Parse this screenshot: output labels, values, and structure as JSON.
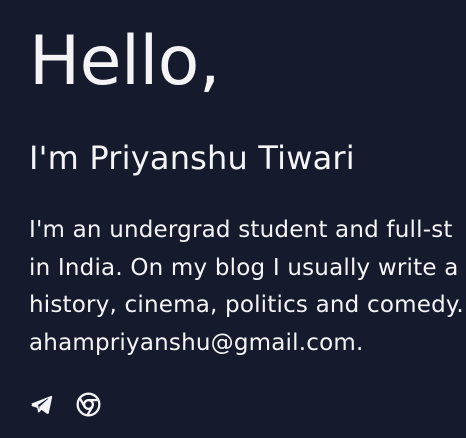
{
  "hero": {
    "greeting": "Hello,",
    "intro": "I'm Priyanshu Tiwari",
    "bio_lines": [
      "I'm an undergrad student and full-st",
      "in India. On my blog I usually write a",
      "history, cinema, politics and comedy.",
      "ahampriyanshu@gmail.com."
    ]
  },
  "social": {
    "links": [
      {
        "icon": "telegram-icon"
      },
      {
        "icon": "chrome-icon"
      }
    ]
  },
  "theme": {
    "background": "#151a2d",
    "text": "#f4f4f6"
  }
}
